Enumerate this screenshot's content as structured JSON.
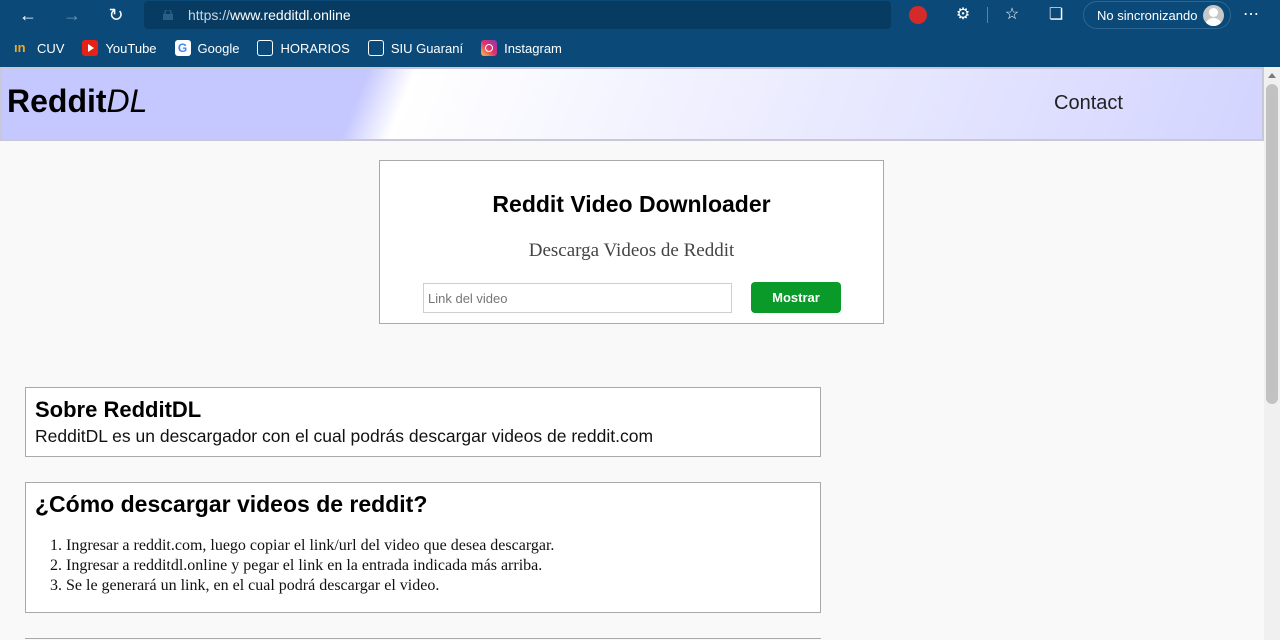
{
  "browser": {
    "url_prefix": "https://",
    "url_host": "www.redditdl.online",
    "profile_label": "No sincronizando",
    "bookmarks": [
      {
        "label": "CUV",
        "icon": "cuv-icon"
      },
      {
        "label": "YouTube",
        "icon": "youtube-icon"
      },
      {
        "label": "Google",
        "icon": "google-icon"
      },
      {
        "label": "HORARIOS",
        "icon": "page-icon"
      },
      {
        "label": "SIU Guaraní",
        "icon": "page-icon"
      },
      {
        "label": "Instagram",
        "icon": "instagram-icon"
      }
    ]
  },
  "site": {
    "logo_main": "Reddit",
    "logo_italic": "DL",
    "nav_contact": "Contact"
  },
  "downloader": {
    "title": "Reddit Video Downloader",
    "subtitle": "Descarga Videos de Reddit",
    "input_placeholder": "Link del video",
    "input_value": "",
    "button_label": "Mostrar"
  },
  "about": {
    "title": "Sobre RedditDL",
    "text": "RedditDL es un descargador con el cual podrás descargar videos de reddit.com"
  },
  "howto": {
    "title": "¿Cómo descargar videos de reddit?",
    "steps": [
      "Ingresar a reddit.com, luego copiar el link/url del video que desea descargar.",
      "Ingresar a redditdl.online y pegar el link en la entrada indicada más arriba.",
      "Se le generará un link, en el cual podrá descargar el video."
    ]
  },
  "colors": {
    "browser_chrome": "#0b4a78",
    "header_lavender": "#c5c7ff",
    "button_green": "#0a9a2a"
  }
}
